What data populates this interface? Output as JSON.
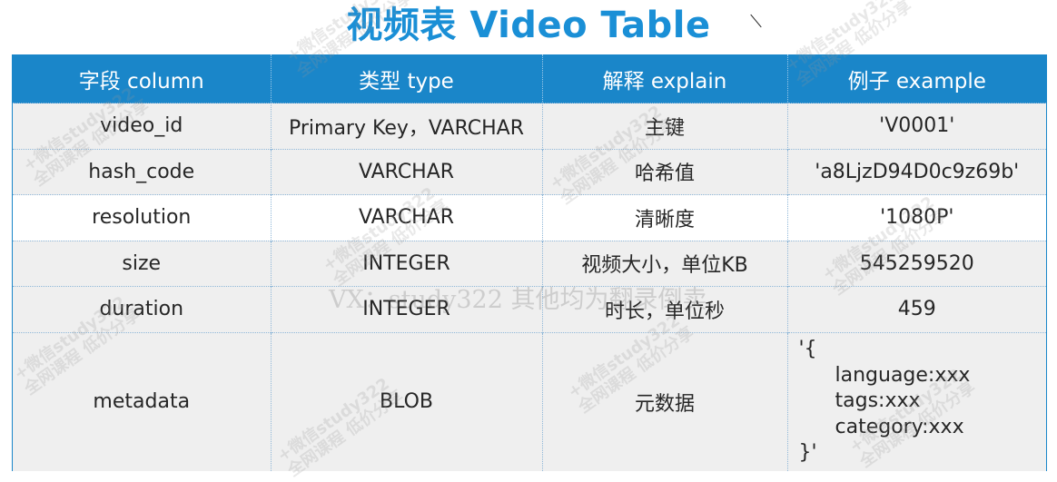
{
  "title": "视频表  Video Table",
  "headers": [
    "字段 column",
    "类型 type",
    "解释 explain",
    "例子 example"
  ],
  "rows": [
    {
      "column": "video_id",
      "type": "Primary Key，VARCHAR",
      "explain": "主键",
      "example": "'V0001'"
    },
    {
      "column": "hash_code",
      "type": "VARCHAR",
      "explain": "哈希值",
      "example": "'a8LjzD94D0c9z69b'"
    },
    {
      "column": "resolution",
      "type": "VARCHAR",
      "explain": "清晰度",
      "example": "'1080P'"
    },
    {
      "column": "size",
      "type": "INTEGER",
      "explain": "视频大小，单位KB",
      "example": "545259520"
    },
    {
      "column": "duration",
      "type": "INTEGER",
      "explain": "时长，单位秒",
      "example": "459"
    }
  ],
  "metadata_row": {
    "column": "metadata",
    "type": "BLOB",
    "explain": "元数据",
    "example_lines": [
      "'{",
      "language:xxx",
      "tags:xxx",
      "category:xxx",
      "}'"
    ]
  },
  "watermark": {
    "line1": "+微信study322",
    "line2": "全网课程 低价分享",
    "center_text": "VX：study322 其他均为翻录倒卖"
  },
  "colors": {
    "title": "#1a8fd6",
    "header_bg": "#1a86c9",
    "row_alt_bg": "#efefef"
  }
}
